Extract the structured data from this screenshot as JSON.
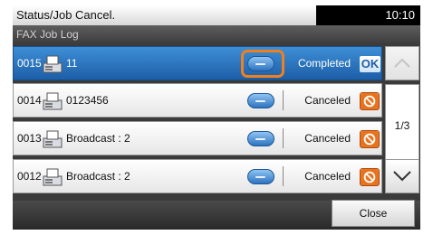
{
  "header": {
    "title": "Status/Job Cancel.",
    "time": "10:10"
  },
  "subtitle": "FAX Job Log",
  "jobs": [
    {
      "number": "0015",
      "destination": "11",
      "status": "Completed",
      "badge": "OK"
    },
    {
      "number": "0014",
      "destination": "0123456",
      "status": "Canceled"
    },
    {
      "number": "0013",
      "destination": "Broadcast : 2",
      "status": "Canceled"
    },
    {
      "number": "0012",
      "destination": "Broadcast : 2",
      "status": "Canceled"
    }
  ],
  "pager": {
    "label": "1/3"
  },
  "close_label": "Close",
  "colors": {
    "selected_row": "#1d5ea8",
    "highlight": "#f0801e",
    "cancel_badge": "#e0661a"
  }
}
